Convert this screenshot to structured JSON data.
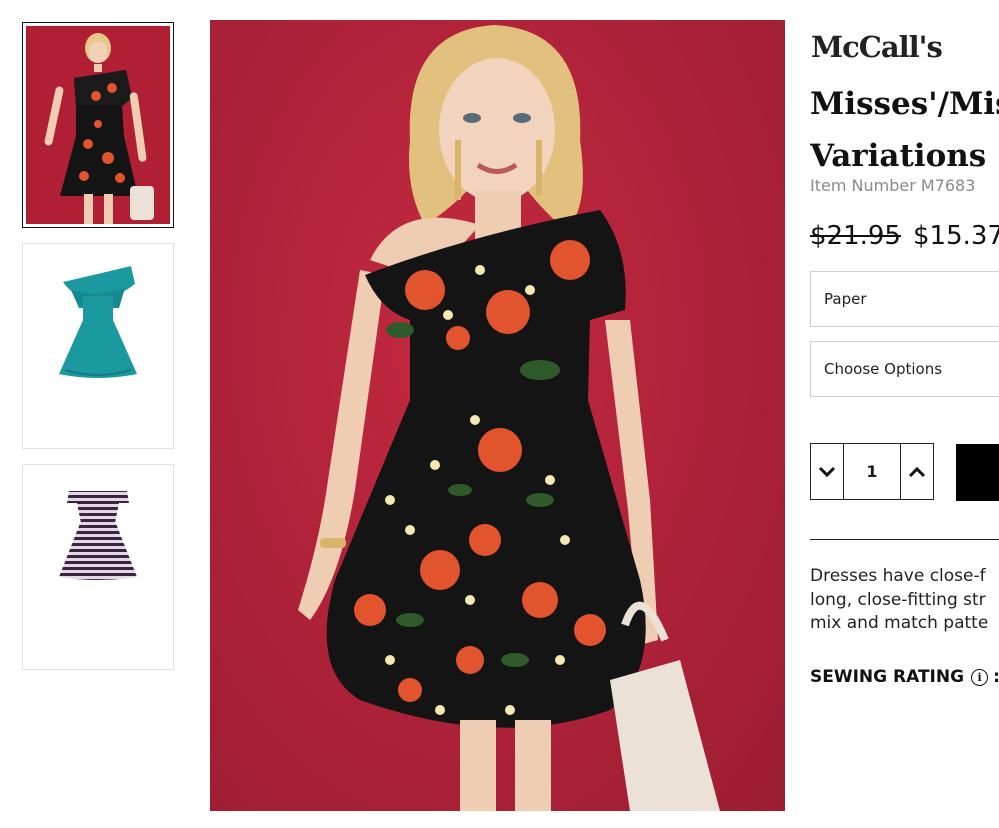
{
  "brand": {
    "name": "McCall's"
  },
  "product": {
    "title_line1": "Misses'/Miss",
    "title_line2": "Variations",
    "item_number": "Item Number M7683",
    "price_old": "$21.95",
    "price_new": "$15.37"
  },
  "format_select": {
    "value": "Paper"
  },
  "options_select": {
    "value": "Choose Options"
  },
  "quantity": {
    "value": "1"
  },
  "description": {
    "line1": "Dresses have close-f",
    "line2": "long, close-fitting str",
    "line3": "mix and match patte"
  },
  "sewing_rating": {
    "label": "SEWING RATING",
    "info_glyph": "i",
    "suffix": ":"
  },
  "colors": {
    "background_red": "#b2233a",
    "dress_teal": "#1a9aa0",
    "dress_black": "#141414",
    "floral_orange": "#e2542e"
  },
  "icons": [
    "chevron-down-icon",
    "chevron-up-icon",
    "info-icon"
  ]
}
